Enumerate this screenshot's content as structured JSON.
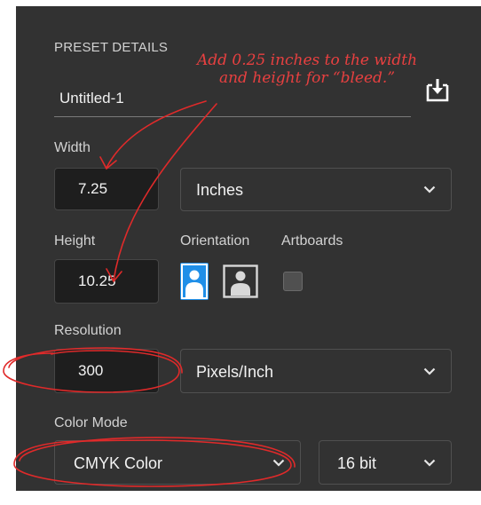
{
  "panel": {
    "section_title": "PRESET DETAILS",
    "preset_name": "Untitled-1",
    "icons": {
      "save_preset": "download-icon",
      "portrait": "portrait-person-icon",
      "landscape": "landscape-person-icon",
      "dropdown": "chevron-down-icon"
    }
  },
  "width": {
    "label": "Width",
    "value": "7.25",
    "unit": "Inches"
  },
  "height": {
    "label": "Height",
    "value": "10.25"
  },
  "orientation": {
    "label": "Orientation",
    "selected": "portrait"
  },
  "artboards": {
    "label": "Artboards",
    "checked": false
  },
  "resolution": {
    "label": "Resolution",
    "value": "300",
    "unit": "Pixels/Inch"
  },
  "color_mode": {
    "label": "Color Mode",
    "mode": "CMYK Color",
    "bit_depth": "16 bit"
  },
  "annotation": {
    "line1": "Add 0.25 inches to the width",
    "line2": "and height for “bleed.”"
  },
  "colors": {
    "panel_bg": "#323232",
    "field_bg": "#1e1e1e",
    "accent_blue": "#1f8fe8",
    "annotation_red": "#e84040"
  }
}
